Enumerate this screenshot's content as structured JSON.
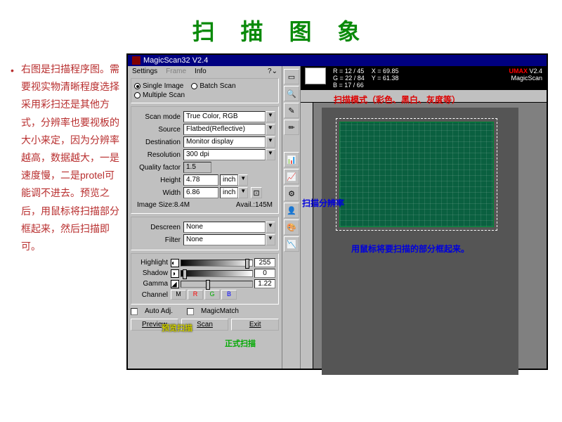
{
  "page": {
    "title": "扫 描 图 象",
    "description": "右图是扫描程序图。需要视实物清晰程度选择采用彩扫还是其他方式，分辨率也要视板的大小来定，因为分辨率越高，数据越大，一是速度慢，二是protel可能调不进去。预览之后，用鼠标将扫描部分框起来，然后扫描即可。"
  },
  "window": {
    "title": "MagicScan32 V2.4"
  },
  "menubar": {
    "settings": "Settings",
    "frame": "Frame",
    "info": "Info"
  },
  "status": {
    "r": "R = 12 / 45",
    "g": "G = 22 / 84",
    "b": "B = 17 / 66",
    "x": "X = 69.85",
    "y": "Y = 61.38",
    "brand": "UMAX",
    "version": "V2.4",
    "product": "MagicScan"
  },
  "scanType": {
    "single": "Single Image",
    "batch": "Batch Scan",
    "multiple": "Multiple Scan"
  },
  "settings": {
    "scanMode": {
      "label": "Scan mode",
      "value": "True Color, RGB"
    },
    "source": {
      "label": "Source",
      "value": "Flatbed(Reflective)"
    },
    "destination": {
      "label": "Destination",
      "value": "Monitor display"
    },
    "resolution": {
      "label": "Resolution",
      "value": "300 dpi"
    },
    "qualityFactor": {
      "label": "Quality factor",
      "value": "1.5"
    },
    "height": {
      "label": "Height",
      "value": "4.78",
      "unit": "inch"
    },
    "width": {
      "label": "Width",
      "value": "6.86",
      "unit": "inch"
    },
    "imageSize": {
      "label": "Image Size:",
      "value": "8.4M"
    },
    "avail": {
      "label": "Avail.:",
      "value": "145M"
    }
  },
  "filters": {
    "descreen": {
      "label": "Descreen",
      "value": "None"
    },
    "filter": {
      "label": "Filter",
      "value": "None"
    }
  },
  "adjust": {
    "highlight": {
      "label": "Highlight",
      "value": "255"
    },
    "shadow": {
      "label": "Shadow",
      "value": "0"
    },
    "gamma": {
      "label": "Gamma",
      "value": "1.22"
    },
    "channel": {
      "label": "Channel",
      "m": "M",
      "r": "R",
      "g": "G",
      "b": "B"
    }
  },
  "checks": {
    "autoAdj": "Auto Adj.",
    "magicMatch": "MagicMatch"
  },
  "buttons": {
    "preview": "Preview",
    "scan": "Scan",
    "exit": "Exit"
  },
  "annotations": {
    "scanMode": "扫描模式（彩色、黑白、灰度等）",
    "resolution": "扫描分辨率",
    "selection": "用鼠标将要扫描的部分框起来。",
    "preview": "预览扫描",
    "scan": "正式扫描"
  }
}
